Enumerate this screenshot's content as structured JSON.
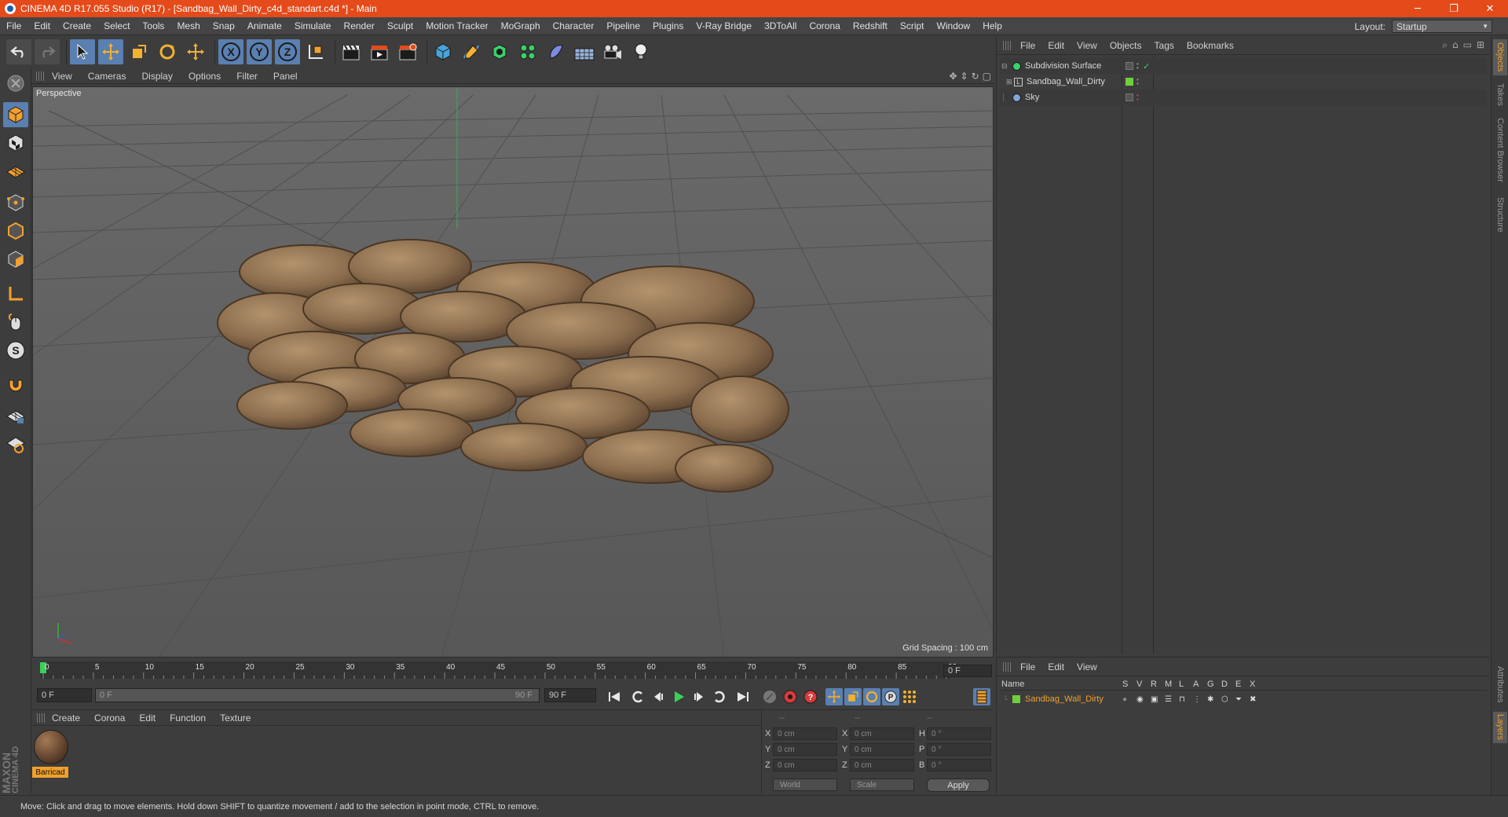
{
  "window": {
    "title": "CINEMA 4D R17.055 Studio (R17) - [Sandbag_Wall_Dirty_c4d_standart.c4d *] - Main",
    "controls": [
      "─",
      "❐",
      "✕"
    ]
  },
  "menubar": {
    "items": [
      "File",
      "Edit",
      "Create",
      "Select",
      "Tools",
      "Mesh",
      "Snap",
      "Animate",
      "Simulate",
      "Render",
      "Sculpt",
      "Motion Tracker",
      "MoGraph",
      "Character",
      "Pipeline",
      "Plugins",
      "V-Ray Bridge",
      "3DToAll",
      "Corona",
      "Redshift",
      "Script",
      "Window",
      "Help"
    ]
  },
  "layout": {
    "label": "Layout:",
    "value": "Startup"
  },
  "viewport": {
    "menu": [
      "View",
      "Cameras",
      "Display",
      "Options",
      "Filter",
      "Panel"
    ],
    "camera_label": "Perspective",
    "grid_spacing": "Grid Spacing : 100 cm"
  },
  "timeline": {
    "ticks": [
      "0",
      "5",
      "10",
      "15",
      "20",
      "25",
      "30",
      "35",
      "40",
      "45",
      "50",
      "55",
      "60",
      "65",
      "70",
      "75",
      "80",
      "85",
      "90"
    ],
    "current_frame": "0 F",
    "start_field": "0 F",
    "range_start": "0 F",
    "range_end": "90 F",
    "end_field": "90 F",
    "playhead_frame": 0
  },
  "material_panel": {
    "menu": [
      "Create",
      "Corona",
      "Edit",
      "Function",
      "Texture"
    ],
    "material_name": "Barricad"
  },
  "coordinates": {
    "headers": [
      "--",
      "--",
      "--"
    ],
    "rows": [
      {
        "pos_label": "X",
        "pos": "0 cm",
        "size_label": "X",
        "size": "0 cm",
        "rot_label": "H",
        "rot": "0 °"
      },
      {
        "pos_label": "Y",
        "pos": "0 cm",
        "size_label": "Y",
        "size": "0 cm",
        "rot_label": "P",
        "rot": "0 °"
      },
      {
        "pos_label": "Z",
        "pos": "0 cm",
        "size_label": "Z",
        "size": "0 cm",
        "rot_label": "B",
        "rot": "0 °"
      }
    ],
    "space": "World",
    "mode": "Scale",
    "apply": "Apply"
  },
  "objects_panel": {
    "menu": [
      "File",
      "Edit",
      "View",
      "Objects",
      "Tags",
      "Bookmarks"
    ],
    "objects": [
      {
        "name": "Subdivision Surface",
        "icon": "subdivision-icon",
        "color": "#3ad06a"
      },
      {
        "name": "Sandbag_Wall_Dirty",
        "icon": "polygon-object-icon",
        "color": "#6fcf3b"
      },
      {
        "name": "Sky",
        "icon": "sky-icon",
        "color": "#7fa6d8"
      }
    ]
  },
  "layers_panel": {
    "menu": [
      "File",
      "Edit",
      "View"
    ],
    "columns": [
      "Name",
      "S",
      "V",
      "R",
      "M",
      "L",
      "A",
      "G",
      "D",
      "E",
      "X"
    ],
    "layer": {
      "name": "Sandbag_Wall_Dirty",
      "color": "#6fcf3b"
    }
  },
  "side_tabs": [
    "Objects",
    "Takes",
    "Content Browser",
    "Structure"
  ],
  "side_tabs_lower": [
    "Attributes",
    "Layers"
  ],
  "logo": {
    "line1": "MAXON",
    "line2": "CINEMA 4D"
  },
  "status": "Move: Click and drag to move elements. Hold down SHIFT to quantize movement / add to the selection in point mode, CTRL to remove.",
  "colors": {
    "titlebar": "#e44a1a",
    "highlight": "#5a7fb1",
    "selection": "#f0a02c"
  }
}
